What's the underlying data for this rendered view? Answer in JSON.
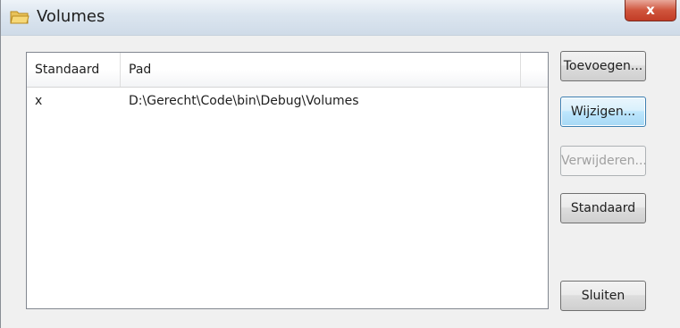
{
  "window": {
    "title": "Volumes",
    "close_glyph": "x"
  },
  "listview": {
    "columns": [
      "Standaard",
      "Pad"
    ],
    "rows": [
      {
        "standaard": "x",
        "pad": "D:\\Gerecht\\Code\\bin\\Debug\\Volumes"
      }
    ]
  },
  "buttons": {
    "add": "Toevoegen...",
    "edit": "Wijzigen...",
    "remove": "Verwijderen...",
    "default": "Standaard",
    "close": "Sluiten"
  },
  "icons": {
    "title": "folder-icon",
    "close": "close-icon"
  },
  "colors": {
    "focus_border": "#3c7fb1",
    "close_button": "#c23d26"
  }
}
